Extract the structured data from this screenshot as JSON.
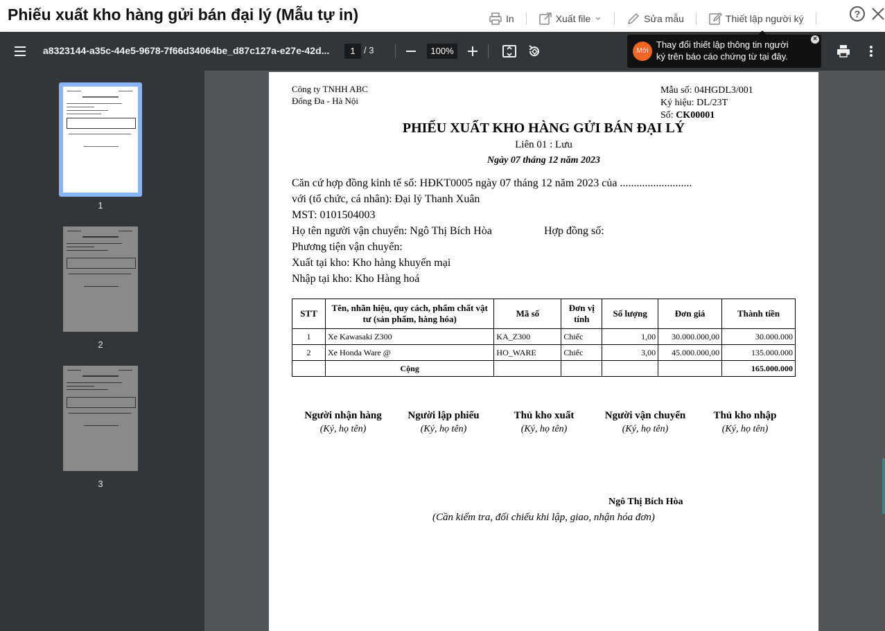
{
  "window": {
    "title": "Phiếu xuất kho hàng gửi bán đại lý (Mẫu tự in)",
    "actions": [
      {
        "label": "In",
        "icon": "printer-icon"
      },
      {
        "label": "Xuất file",
        "icon": "export-icon"
      },
      {
        "label": "Sửa mẫu",
        "icon": "pencil-icon"
      },
      {
        "label": "Thiết lập người ký",
        "icon": "edit-signer-icon"
      }
    ]
  },
  "pdf_toolbar": {
    "filename": "a8323144-a35c-44e5-9678-7f66d34064be_d87c127a-e27e-42d...",
    "current_page": "1",
    "total_pages": "/ 3",
    "zoom": "100%"
  },
  "tooltip": {
    "badge": "Mới",
    "text": "Thay đổi thiết lập thông tin người ký trên báo cáo chứng từ tại đây."
  },
  "thumbnails": [
    {
      "label": "1"
    },
    {
      "label": "2"
    },
    {
      "label": "3"
    }
  ],
  "document": {
    "company_name": "Công ty TNHH ABC",
    "company_address": "Đống Đa - Hà Nội",
    "form_no": "Mẫu số: 04HGDL3/001",
    "symbol": "Ký hiệu: DL/23T",
    "number_label": "Số: ",
    "number_value": "CK00001",
    "title": "PHIẾU XUẤT KHO HÀNG GỬI BÁN ĐẠI LÝ",
    "copy": "Liên 01 : Lưu",
    "date": "Ngày 07 tháng 12 năm 2023",
    "contract_line": "Căn cứ hợp đồng kinh tế số: HĐKT0005 ngày 07 tháng 12 năm 2023 của ..........................",
    "party_line": "với (tổ chức, cá nhân): Đại lý Thanh Xuân",
    "tax_line": "MST: 0101504003",
    "carrier_line": "Họ tên người vận chuyển: Ngô Thị Bích Hòa",
    "carrier_contract": "Hợp đồng số:",
    "vehicle_line": "Phương tiện vận chuyển:",
    "from_warehouse": "Xuất tại kho: Kho hàng khuyến mại",
    "to_warehouse": "Nhập tại kho: Kho Hàng hoá",
    "table": {
      "headers": [
        "STT",
        "Tên, nhãn hiệu, quy cách, phẩm chất vật tư (sản phẩm, hàng hóa)",
        "Mã số",
        "Đơn vị tính",
        "Số lượng",
        "Đơn giá",
        "Thành tiền"
      ],
      "rows": [
        [
          "1",
          "Xe Kawasaki Z300",
          "KA_Z300",
          "Chiếc",
          "1,00",
          "30.000.000,00",
          "30.000.000"
        ],
        [
          "2",
          "Xe Honda Ware @",
          "HO_WARE",
          "Chiếc",
          "3,00",
          "45.000.000,00",
          "135.000.000"
        ]
      ],
      "total_label": "Cộng",
      "total_value": "165.000.000"
    },
    "signatures": [
      {
        "title": "Người nhận hàng",
        "note": "(Ký, họ tên)"
      },
      {
        "title": "Người lập phiếu",
        "note": "(Ký, họ tên)"
      },
      {
        "title": "Thủ kho xuất",
        "note": "(Ký, họ tên)"
      },
      {
        "title": "Người vận chuyển",
        "note": "(Ký, họ tên)"
      },
      {
        "title": "Thủ kho nhập",
        "note": "(Ký, họ tên)"
      }
    ],
    "signer_name": "Ngô Thị Bích Hòa",
    "footnote": "(Cần kiểm tra, đối chiếu khi lập, giao, nhận hóa đơn)"
  }
}
